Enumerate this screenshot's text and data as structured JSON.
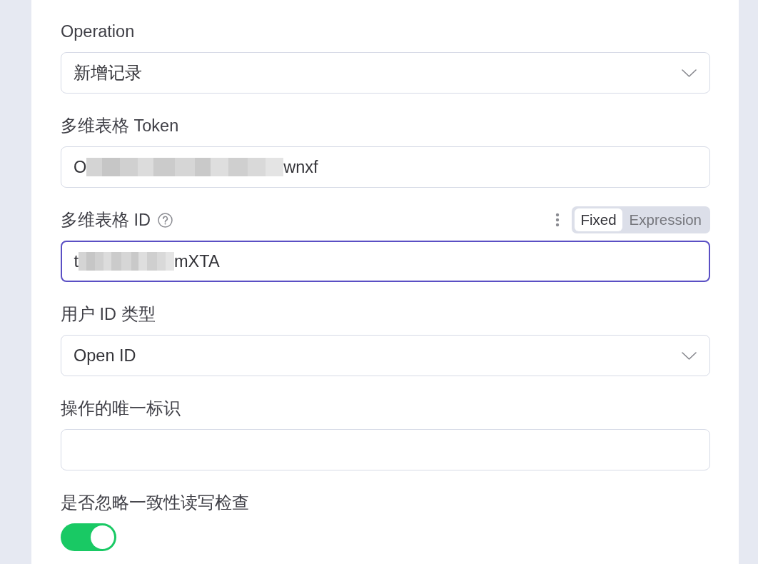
{
  "fields": [
    {
      "kind": "select",
      "label": "Operation",
      "value": "新增记录",
      "focused": false
    },
    {
      "kind": "text",
      "label": "多维表格 Token",
      "focused": false,
      "value_parts": [
        {
          "kind": "text",
          "text": "O"
        },
        {
          "kind": "redaction"
        },
        {
          "kind": "text",
          "text": "wnxf"
        }
      ]
    },
    {
      "kind": "text",
      "label": "多维表格 ID",
      "help": true,
      "options_menu": true,
      "mode_options": [
        {
          "label": "Fixed",
          "selected": true
        },
        {
          "label": "Expression",
          "selected": false
        }
      ],
      "focused": true,
      "value_parts": [
        {
          "kind": "text",
          "text": "t"
        },
        {
          "kind": "redaction"
        },
        {
          "kind": "text",
          "text": "mXTA"
        }
      ]
    },
    {
      "kind": "select",
      "label": "用户 ID 类型",
      "value": "Open ID",
      "focused": false
    },
    {
      "kind": "text",
      "label": "操作的唯一标识",
      "focused": false
    },
    {
      "kind": "toggle",
      "label": "是否忽略一致性读写检查",
      "on": true
    }
  ]
}
